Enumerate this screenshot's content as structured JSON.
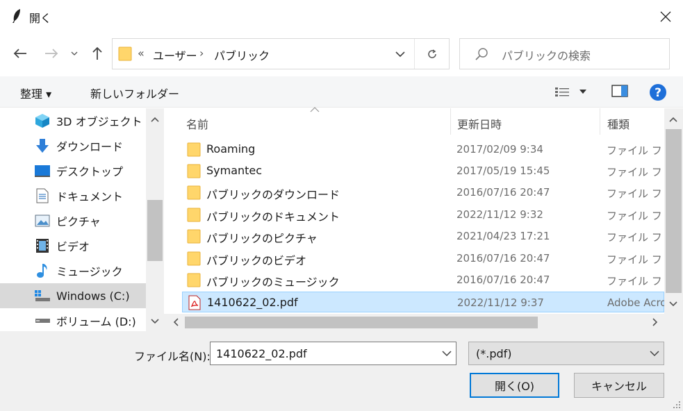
{
  "window": {
    "title": "開く"
  },
  "address": {
    "prefix": "«",
    "segments": [
      "ユーザー",
      "パブリック"
    ],
    "separator": "›"
  },
  "search": {
    "placeholder": "パブリックの検索"
  },
  "toolbar": {
    "organize_label": "整理 ▾",
    "new_folder_label": "新しいフォルダー"
  },
  "sidebar": {
    "items": [
      {
        "label": "3D オブジェクト",
        "icon": "cube-3d-icon"
      },
      {
        "label": "ダウンロード",
        "icon": "download-arrow-icon"
      },
      {
        "label": "デスクトップ",
        "icon": "desktop-icon"
      },
      {
        "label": "ドキュメント",
        "icon": "document-icon"
      },
      {
        "label": "ピクチャ",
        "icon": "pictures-icon"
      },
      {
        "label": "ビデオ",
        "icon": "video-icon"
      },
      {
        "label": "ミュージック",
        "icon": "music-note-icon"
      },
      {
        "label": "Windows (C:)",
        "icon": "drive-c-icon",
        "selected": true
      },
      {
        "label": "ボリューム (D:)",
        "icon": "drive-icon"
      }
    ]
  },
  "columns": {
    "name": "名前",
    "date": "更新日時",
    "type": "種類"
  },
  "files": [
    {
      "name": "Roaming",
      "date": "2017/02/09 9:34",
      "type": "ファイル フォルダー",
      "icon": "folder-icon"
    },
    {
      "name": "Symantec",
      "date": "2017/05/19 15:45",
      "type": "ファイル フォルダー",
      "icon": "folder-icon"
    },
    {
      "name": "パブリックのダウンロード",
      "date": "2016/07/16 20:47",
      "type": "ファイル フォルダー",
      "icon": "folder-icon"
    },
    {
      "name": "パブリックのドキュメント",
      "date": "2022/11/12 9:32",
      "type": "ファイル フォルダー",
      "icon": "folder-icon"
    },
    {
      "name": "パブリックのピクチャ",
      "date": "2021/04/23 17:21",
      "type": "ファイル フォルダー",
      "icon": "folder-icon"
    },
    {
      "name": "パブリックのビデオ",
      "date": "2016/07/16 20:47",
      "type": "ファイル フォルダー",
      "icon": "folder-icon"
    },
    {
      "name": "パブリックのミュージック",
      "date": "2016/07/16 20:47",
      "type": "ファイル フォルダー",
      "icon": "folder-icon"
    },
    {
      "name": "1410622_02.pdf",
      "date": "2022/11/12 9:37",
      "type": "Adobe Acrobat Document",
      "icon": "pdf-icon",
      "selected": true
    }
  ],
  "filename": {
    "label": "ファイル名(N):",
    "value": "1410622_02.pdf"
  },
  "filetype": {
    "value": "(*.pdf)"
  },
  "buttons": {
    "open": "開く(O)",
    "cancel": "キャンセル"
  },
  "colors": {
    "accent": "#0078d7",
    "selection": "#cce8ff",
    "folder": "#ffd66b"
  }
}
